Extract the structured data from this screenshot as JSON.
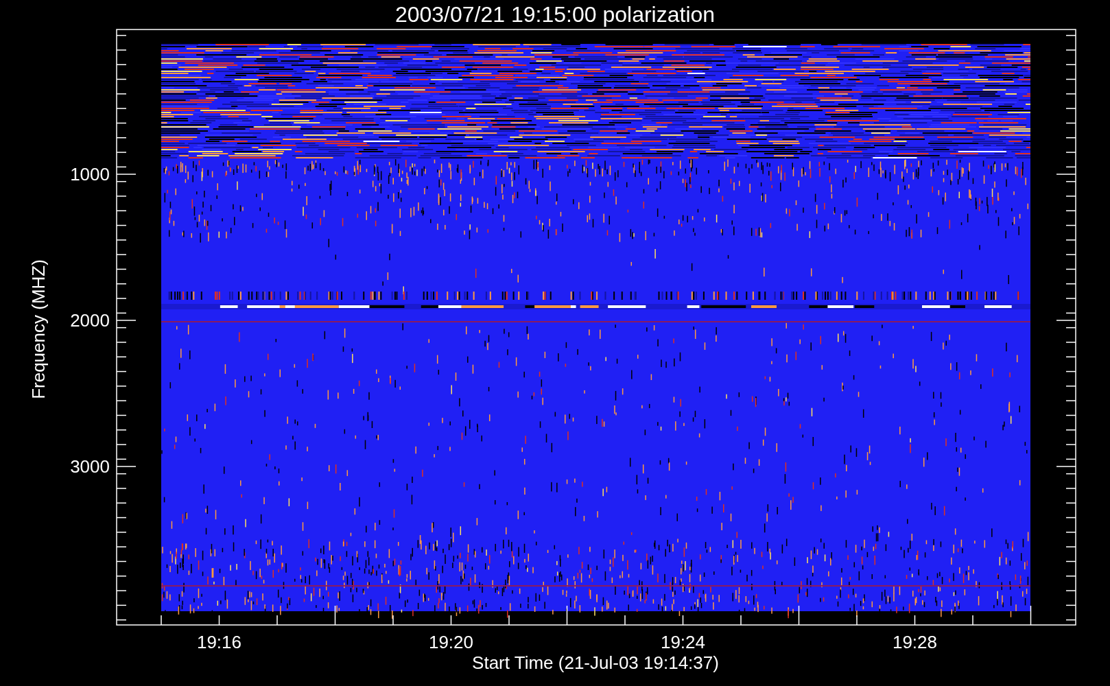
{
  "title": "2003/07/21 19:15:00 polarization",
  "y_axis": {
    "label": "Frequency (MHZ)",
    "ticks": [
      "1000",
      "2000",
      "3000"
    ]
  },
  "x_axis": {
    "label": "Start Time (21-Jul-03 19:14:37)",
    "ticks": [
      "19:16",
      "19:20",
      "19:24",
      "19:28"
    ]
  }
}
